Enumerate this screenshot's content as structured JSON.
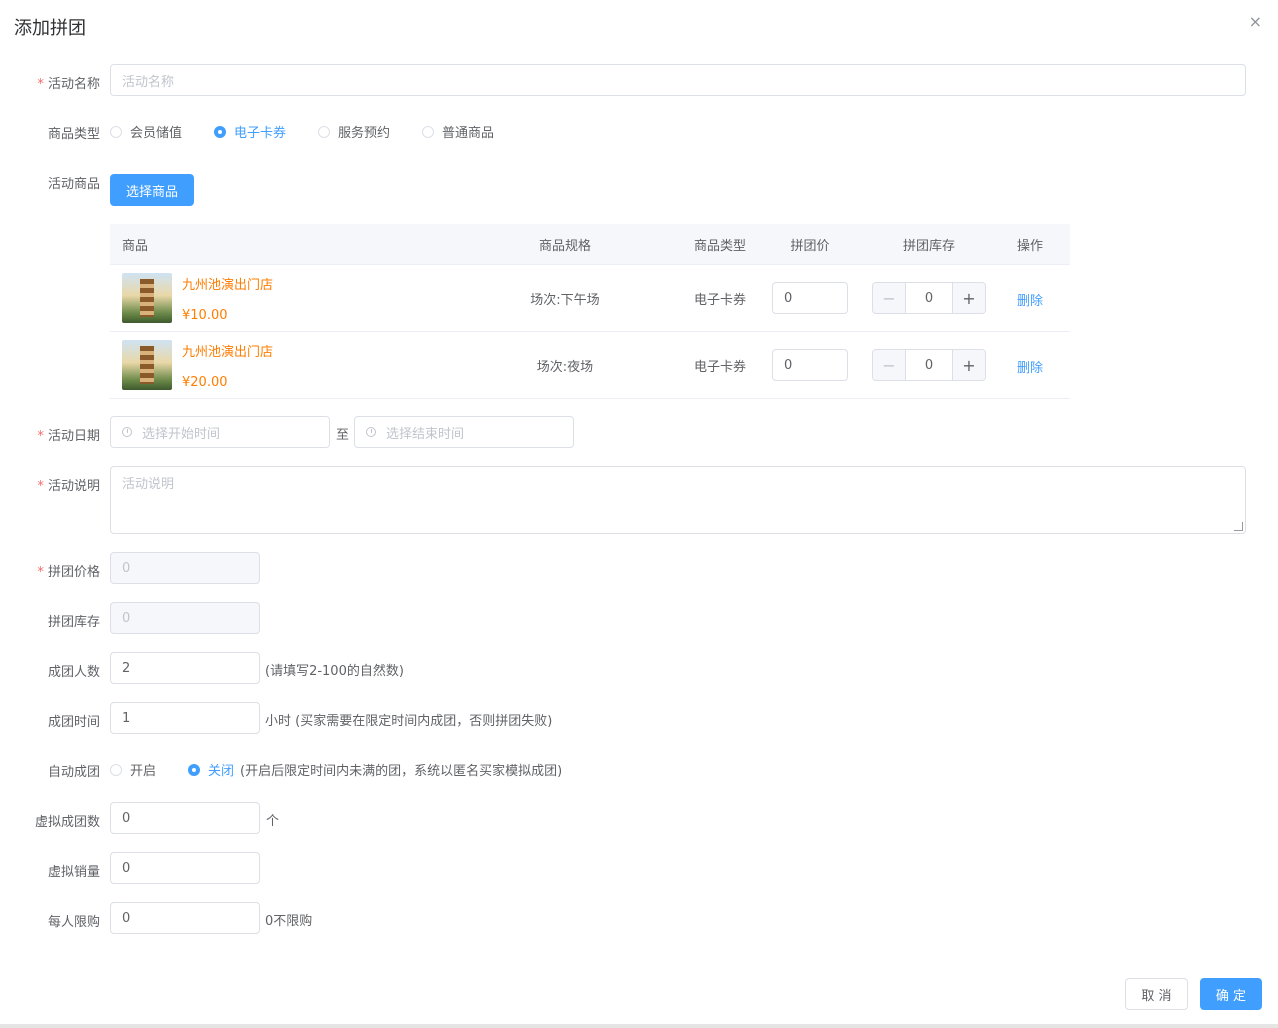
{
  "dialog": {
    "title": "添加拼团",
    "close": "×"
  },
  "fields": {
    "activity_name": {
      "label": "活动名称",
      "placeholder": "活动名称"
    },
    "product_type": {
      "label": "商品类型",
      "options": [
        "会员储值",
        "电子卡券",
        "服务预约",
        "普通商品"
      ],
      "selected": "电子卡券"
    },
    "activity_products": {
      "label": "活动商品",
      "button": "选择商品"
    },
    "activity_date": {
      "label": "活动日期",
      "start_placeholder": "选择开始时间",
      "separator": "至",
      "end_placeholder": "选择结束时间"
    },
    "activity_desc": {
      "label": "活动说明",
      "placeholder": "活动说明"
    },
    "group_price": {
      "label": "拼团价格",
      "value": "0"
    },
    "group_stock": {
      "label": "拼团库存",
      "value": "0"
    },
    "group_size": {
      "label": "成团人数",
      "value": "2",
      "hint": "(请填写2-100的自然数)"
    },
    "group_time": {
      "label": "成团时间",
      "value": "1",
      "hint": "小时 (买家需要在限定时间内成团，否则拼团失败)"
    },
    "auto_group": {
      "label": "自动成团",
      "option_on": "开启",
      "option_off": "关闭",
      "selected": "关闭",
      "hint": "(开启后限定时间内未满的团，系统以匿名买家模拟成团)"
    },
    "virtual_groups": {
      "label": "虚拟成团数",
      "value": "0",
      "unit": "个"
    },
    "virtual_sales": {
      "label": "虚拟销量",
      "value": "0"
    },
    "purchase_limit": {
      "label": "每人限购",
      "value": "0",
      "hint": "0不限购"
    }
  },
  "table": {
    "headers": [
      "商品",
      "商品规格",
      "商品类型",
      "拼团价",
      "拼团库存",
      "操作"
    ],
    "rows": [
      {
        "name": "九州池演出门店",
        "price": "¥10.00",
        "spec": "场次:下午场",
        "type": "电子卡券",
        "group_price": "0",
        "stock": "0",
        "action": "删除"
      },
      {
        "name": "九州池演出门店",
        "price": "¥20.00",
        "spec": "场次:夜场",
        "type": "电子卡券",
        "group_price": "0",
        "stock": "0",
        "action": "删除"
      }
    ]
  },
  "footer": {
    "cancel": "取 消",
    "confirm": "确 定"
  },
  "colors": {
    "primary": "#409eff",
    "required": "#f56c6c",
    "price": "#ff7d00"
  }
}
